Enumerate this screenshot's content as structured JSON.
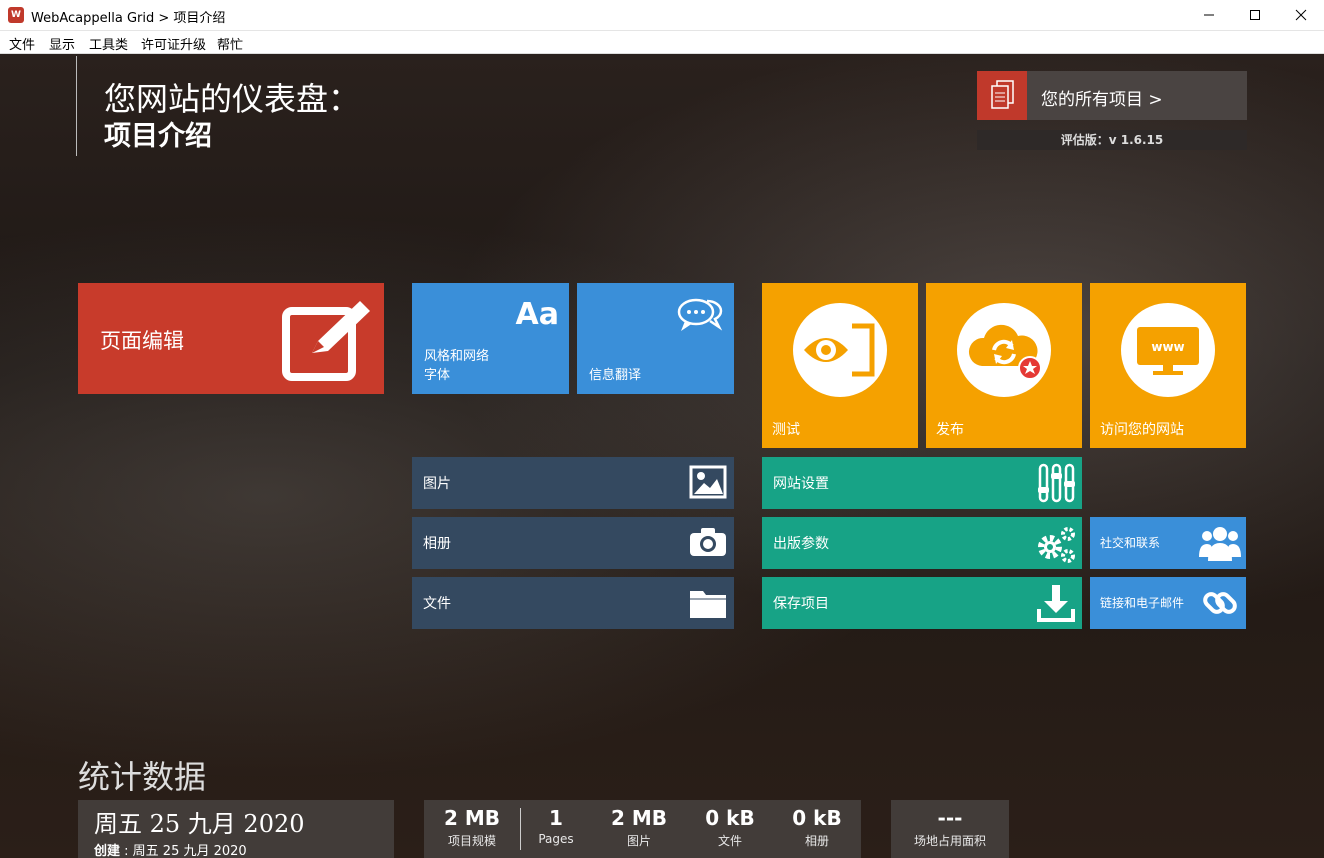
{
  "window": {
    "title": "WebAcappella Grid > 项目介绍",
    "icon_text": "W"
  },
  "menu": [
    "文件",
    "显示",
    "工具类",
    "许可证升级",
    "帮忙"
  ],
  "header": {
    "title": "您网站的仪表盘：",
    "subtitle": "项目介绍",
    "projects_button": "您的所有项目 >",
    "version": "评估版：v 1.6.15"
  },
  "tiles": {
    "page_edit": "页面编辑",
    "styles": [
      "风格和网络",
      "字体"
    ],
    "styles_glyph": "Aa",
    "translate": "信息翻译",
    "test": "测试",
    "publish": "发布",
    "visit": "访问您的网站",
    "visit_glyph": "www",
    "images": "图片",
    "albums": "相册",
    "files": "文件",
    "site_settings": "网站设置",
    "publish_params": "出版参数",
    "save_project": "保存项目",
    "social": "社交和联系",
    "links_email": "链接和电子邮件"
  },
  "stats": {
    "title": "统计数据",
    "date": "周五 25 九月 2020",
    "created_label": "创建",
    "created_value": "周五 25 九月 2020",
    "cells": [
      {
        "value": "2 MB",
        "caption": "项目规模"
      },
      {
        "value": "1",
        "caption": "Pages"
      },
      {
        "value": "2 MB",
        "caption": "图片"
      },
      {
        "value": "0 kB",
        "caption": "文件"
      },
      {
        "value": "0 kB",
        "caption": "相册"
      }
    ],
    "area": {
      "value": "---",
      "caption": "场地占用面积"
    }
  },
  "colors": {
    "red": "#c83b2b",
    "blue": "#3a8fd9",
    "orange": "#f5a100",
    "navy": "#344960",
    "teal": "#17a386"
  }
}
